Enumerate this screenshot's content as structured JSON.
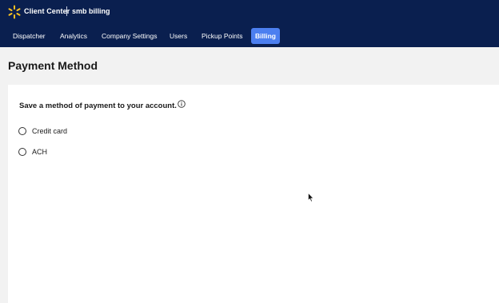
{
  "header": {
    "app_title": "Client Center",
    "account_name": "smb billing",
    "brand_color": "#0a1f4f",
    "spark_color": "#ffc220"
  },
  "nav": {
    "items": [
      {
        "label": "Dispatcher",
        "active": false
      },
      {
        "label": "Analytics",
        "active": false
      },
      {
        "label": "Company Settings",
        "active": false
      },
      {
        "label": "Users",
        "active": false
      },
      {
        "label": "Pickup Points",
        "active": false
      },
      {
        "label": "Billing",
        "active": true
      }
    ],
    "active_color": "#4c7ff0"
  },
  "page": {
    "title": "Payment Method",
    "prompt": "Save a method of payment to your account.",
    "options": [
      {
        "label": "Credit card",
        "selected": false
      },
      {
        "label": "ACH",
        "selected": false
      }
    ]
  }
}
